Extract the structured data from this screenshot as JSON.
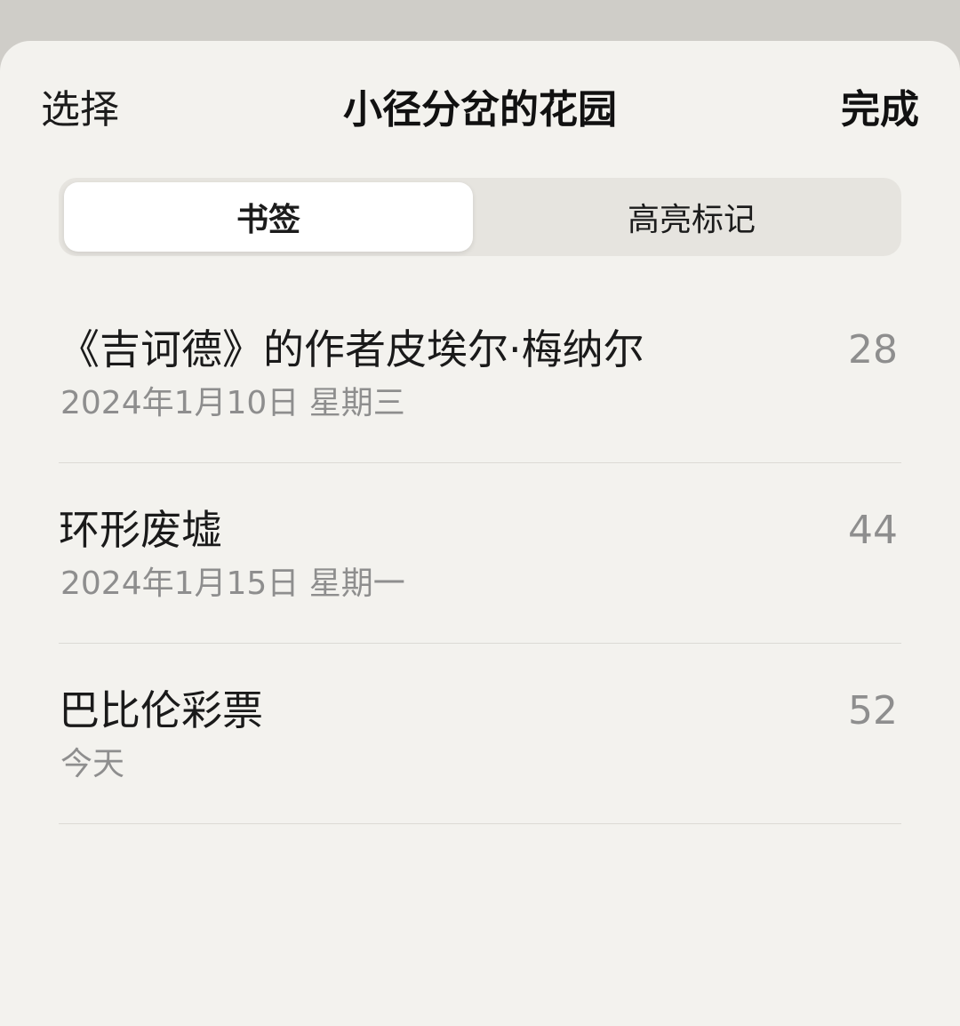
{
  "nav": {
    "select_label": "选择",
    "title": "小径分岔的花园",
    "done_label": "完成"
  },
  "segments": [
    {
      "label": "书签",
      "selected": true
    },
    {
      "label": "高亮标记",
      "selected": false
    }
  ],
  "bookmarks": [
    {
      "title": "《吉诃德》的作者皮埃尔·梅纳尔",
      "date": "2024年1月10日 星期三",
      "page": "28"
    },
    {
      "title": "环形废墟",
      "date": "2024年1月15日 星期一",
      "page": "44"
    },
    {
      "title": "巴比伦彩票",
      "date": "今天",
      "page": "52"
    }
  ],
  "colors": {
    "background": "#f3f2ee",
    "secondary_text": "#8e8e8e",
    "segment_track": "#e6e4df"
  }
}
